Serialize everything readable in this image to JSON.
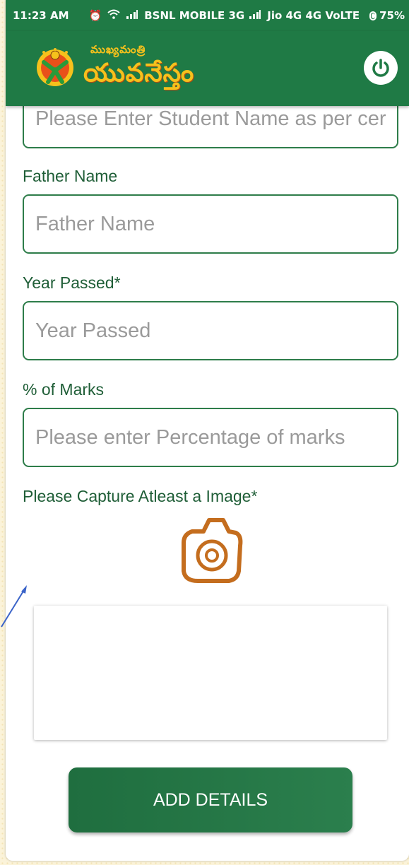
{
  "status_bar": {
    "time": "11:23 AM",
    "carrier1": "BSNL MOBILE 3G",
    "carrier2": "Jio 4G 4G VoLTE",
    "battery": "75%",
    "icons": [
      "alarm-icon",
      "wifi-icon",
      "signal-icon",
      "battery-icon"
    ]
  },
  "app_bar": {
    "logo_small_text": "ముఖ్యమంత్రి",
    "logo_big_text": "యువనేస్తం",
    "logout_icon": "power-icon",
    "accent": "#1f7a45",
    "logo_color": "#f6c11c"
  },
  "form": {
    "student_name": {
      "placeholder": "Please Enter Student Name as per certi",
      "value": ""
    },
    "father_name": {
      "label": "Father Name",
      "placeholder": "Father Name",
      "value": ""
    },
    "year_passed": {
      "label": "Year Passed*",
      "placeholder": "Year Passed",
      "value": ""
    },
    "marks": {
      "label": "% of Marks",
      "placeholder": "Please enter Percentage of marks",
      "value": ""
    },
    "capture": {
      "label": "Please Capture Atleast a Image*",
      "icon": "camera-icon"
    },
    "submit_label": "ADD DETAILS"
  }
}
